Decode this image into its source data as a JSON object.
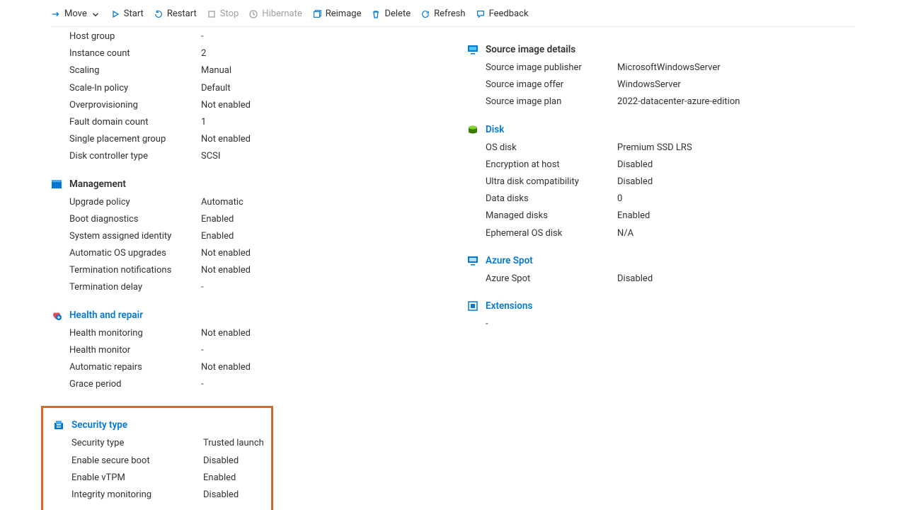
{
  "toolbar": {
    "move": "Move",
    "start": "Start",
    "restart": "Restart",
    "stop": "Stop",
    "hibernate": "Hibernate",
    "reimage": "Reimage",
    "delete": "Delete",
    "refresh": "Refresh",
    "feedback": "Feedback"
  },
  "left": {
    "top": {
      "host_group_l": "Host group",
      "host_group_v": "-",
      "instance_count_l": "Instance count",
      "instance_count_v": "2",
      "scaling_l": "Scaling",
      "scaling_v": "Manual",
      "scalein_l": "Scale-In policy",
      "scalein_v": "Default",
      "overprov_l": "Overprovisioning",
      "overprov_v": "Not enabled",
      "fault_l": "Fault domain count",
      "fault_v": "1",
      "singlepg_l": "Single placement group",
      "singlepg_v": "Not enabled",
      "diskctrl_l": "Disk controller type",
      "diskctrl_v": "SCSI"
    },
    "management": {
      "title": "Management",
      "upgrade_l": "Upgrade policy",
      "upgrade_v": "Automatic",
      "bootdiag_l": "Boot diagnostics",
      "bootdiag_v": "Enabled",
      "sai_l": "System assigned identity",
      "sai_v": "Enabled",
      "autoos_l": "Automatic OS upgrades",
      "autoos_v": "Not enabled",
      "termn_l": "Termination notifications",
      "termn_v": "Not enabled",
      "termd_l": "Termination delay",
      "termd_v": "-"
    },
    "health": {
      "title": "Health and repair",
      "hm_l": "Health monitoring",
      "hm_v": "Not enabled",
      "hmon_l": "Health monitor",
      "hmon_v": "-",
      "ar_l": "Automatic repairs",
      "ar_v": "Not enabled",
      "gp_l": "Grace period",
      "gp_v": "-"
    },
    "security": {
      "title": "Security type",
      "st_l": "Security type",
      "st_v": "Trusted launch",
      "sb_l": "Enable secure boot",
      "sb_v": "Disabled",
      "vtpm_l": "Enable vTPM",
      "vtpm_v": "Enabled",
      "im_l": "Integrity monitoring",
      "im_v": "Disabled"
    }
  },
  "right": {
    "source": {
      "title": "Source image details",
      "pub_l": "Source image publisher",
      "pub_v": "MicrosoftWindowsServer",
      "offer_l": "Source image offer",
      "offer_v": "WindowsServer",
      "plan_l": "Source image plan",
      "plan_v": "2022-datacenter-azure-edition"
    },
    "disk": {
      "title": "Disk",
      "os_l": "OS disk",
      "os_v": "Premium SSD LRS",
      "enc_l": "Encryption at host",
      "enc_v": "Disabled",
      "ultra_l": "Ultra disk compatibility",
      "ultra_v": "Disabled",
      "dd_l": "Data disks",
      "dd_v": "0",
      "md_l": "Managed disks",
      "md_v": "Enabled",
      "eph_l": "Ephemeral OS disk",
      "eph_v": "N/A"
    },
    "spot": {
      "title": "Azure Spot",
      "as_l": "Azure Spot",
      "as_v": "Disabled"
    },
    "ext": {
      "title": "Extensions",
      "val": "-"
    }
  }
}
